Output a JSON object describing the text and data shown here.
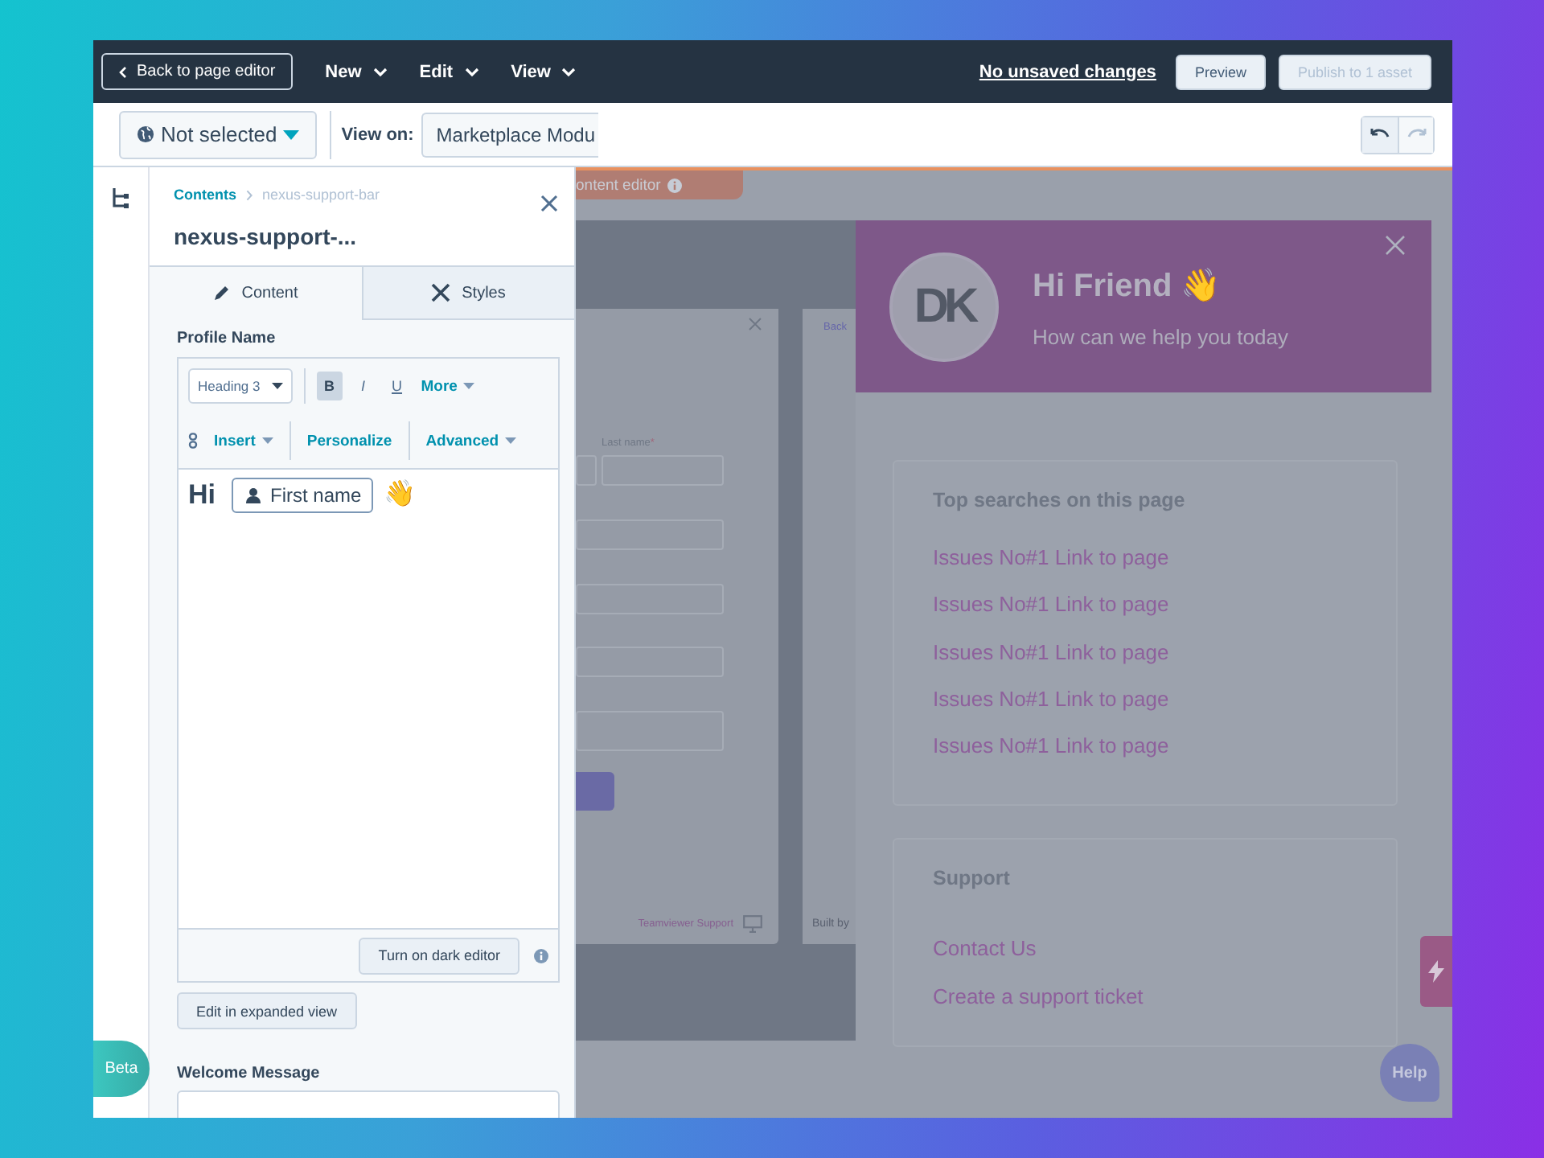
{
  "topbar": {
    "back_button": "Back to page editor",
    "menus": [
      {
        "label": "New"
      },
      {
        "label": "Edit"
      },
      {
        "label": "View"
      }
    ],
    "save_status": "No unsaved changes",
    "preview_button": "Preview",
    "publish_button": {
      "label": "Publish to 1 asset",
      "disabled": true
    }
  },
  "subbar": {
    "language_dropdown": "Not selected",
    "view_on_label": "View on:",
    "view_on_value": "Marketplace Modu",
    "undo": {
      "disabled": false
    },
    "redo": {
      "disabled": true
    }
  },
  "panel": {
    "breadcrumb": [
      "Contents",
      "nexus-support-bar"
    ],
    "title": "nexus-support-...",
    "tabs": [
      {
        "label": "Content",
        "selected": true
      },
      {
        "label": "Styles",
        "selected": false
      }
    ],
    "profile_name": {
      "label": "Profile Name",
      "style_dropdown": "Heading 3",
      "format_buttons": [
        {
          "label": "B",
          "selected": true
        },
        {
          "label": "I",
          "selected": false
        },
        {
          "label": "U",
          "selected": false
        }
      ],
      "more": "More",
      "insert": "Insert",
      "personalize": "Personalize",
      "advanced": "Advanced",
      "content": {
        "text": "Hi",
        "token": "First name",
        "emoji": "👋"
      },
      "dark_editor_button": "Turn on dark editor"
    },
    "expanded_view_button": "Edit in expanded view",
    "welcome_message": {
      "label": "Welcome Message"
    }
  },
  "beta_badge": "Beta",
  "preview": {
    "editor_tab": "ontent editor",
    "form": {
      "field_label": "Last name",
      "required_mark": "*",
      "footer_link": "Teamviewer Support"
    },
    "second_card": {
      "back_link": "Back",
      "footer": "Built by"
    },
    "widget": {
      "logo": "DK",
      "title": "Hi Friend",
      "emoji": "👋",
      "subtitle": "How can we help you today",
      "sections": [
        {
          "title": "Top searches on this page",
          "links": [
            "Issues No#1 Link to page",
            "Issues No#1 Link to page",
            "Issues No#1 Link to page",
            "Issues No#1 Link to page",
            "Issues No#1 Link to page"
          ]
        },
        {
          "title": "Support",
          "links": [
            "Contact Us",
            "Create a support ticket"
          ]
        }
      ],
      "help_button": "Help"
    }
  }
}
